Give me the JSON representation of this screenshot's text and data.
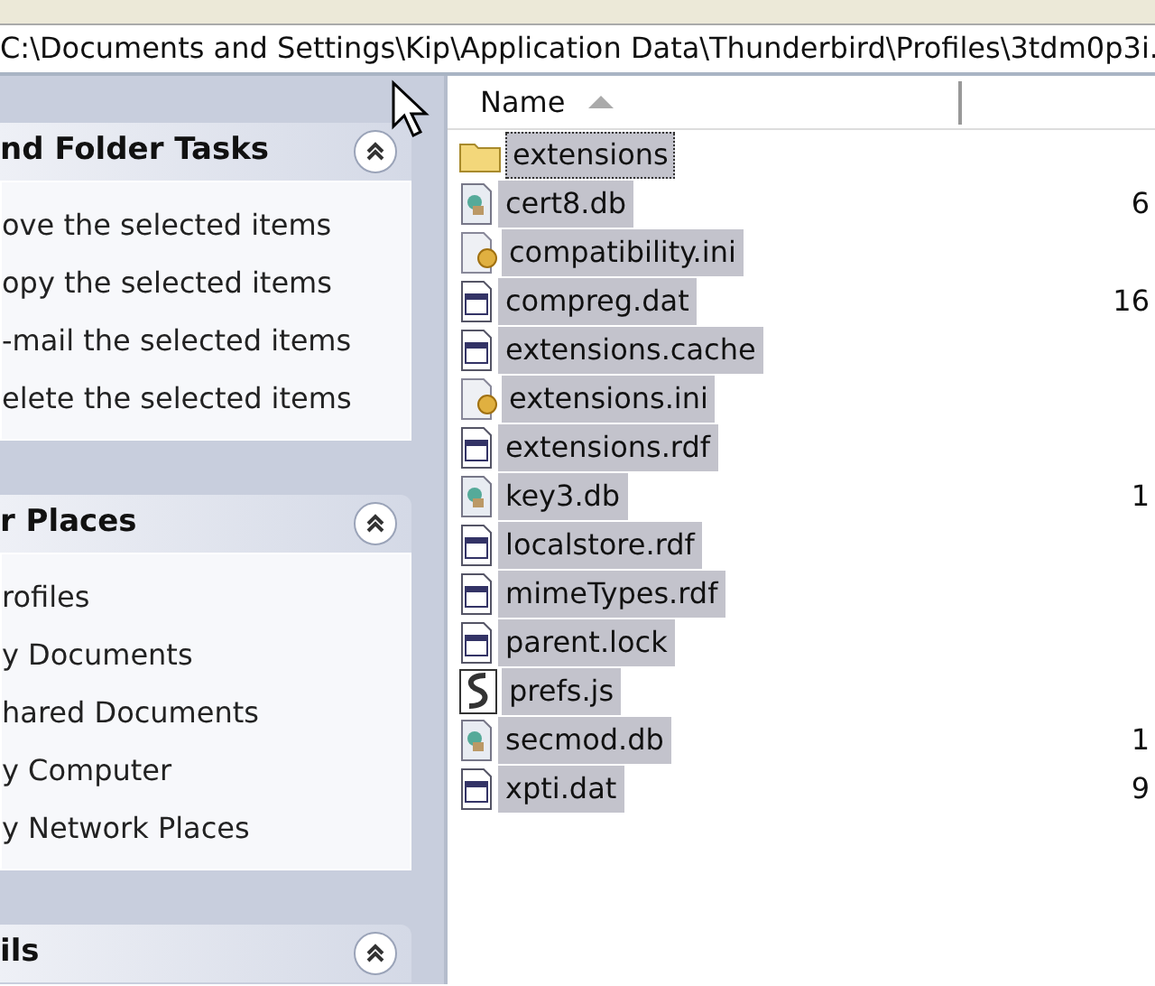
{
  "address_bar": {
    "path": "C:\\Documents and Settings\\Kip\\Application Data\\Thunderbird\\Profiles\\3tdm0p3i."
  },
  "task_panels": [
    {
      "title": "nd Folder Tasks",
      "expanded": true,
      "items": [
        "ove the selected items",
        "opy the selected items",
        "-mail the selected items",
        "elete the selected items"
      ]
    },
    {
      "title": "r Places",
      "expanded": true,
      "items": [
        "rofiles",
        "y Documents",
        "hared Documents",
        "y Computer",
        "y Network Places"
      ]
    },
    {
      "title": "ils",
      "expanded": true
    }
  ],
  "file_list": {
    "columns": [
      {
        "label": "Name",
        "sorted": true
      }
    ],
    "rows": [
      {
        "name": "extensions",
        "kind": "folder",
        "size": "",
        "selected": true,
        "focused": true
      },
      {
        "name": "cert8.db",
        "kind": "db",
        "size": "6",
        "selected": true,
        "focused": false
      },
      {
        "name": "compatibility.ini",
        "kind": "ini",
        "size": "",
        "selected": true,
        "focused": false
      },
      {
        "name": "compreg.dat",
        "kind": "dat",
        "size": "16",
        "selected": true,
        "focused": false
      },
      {
        "name": "extensions.cache",
        "kind": "dat",
        "size": "",
        "selected": true,
        "focused": false
      },
      {
        "name": "extensions.ini",
        "kind": "ini",
        "size": "",
        "selected": true,
        "focused": false
      },
      {
        "name": "extensions.rdf",
        "kind": "dat",
        "size": "",
        "selected": true,
        "focused": false
      },
      {
        "name": "key3.db",
        "kind": "db",
        "size": "1",
        "selected": true,
        "focused": false
      },
      {
        "name": "localstore.rdf",
        "kind": "dat",
        "size": "",
        "selected": true,
        "focused": false
      },
      {
        "name": "mimeTypes.rdf",
        "kind": "dat",
        "size": "",
        "selected": true,
        "focused": false
      },
      {
        "name": "parent.lock",
        "kind": "dat",
        "size": "",
        "selected": true,
        "focused": false
      },
      {
        "name": "prefs.js",
        "kind": "js",
        "size": "",
        "selected": true,
        "focused": false
      },
      {
        "name": "secmod.db",
        "kind": "db",
        "size": "1",
        "selected": true,
        "focused": false
      },
      {
        "name": "xpti.dat",
        "kind": "dat",
        "size": "9",
        "selected": true,
        "focused": false
      }
    ]
  }
}
